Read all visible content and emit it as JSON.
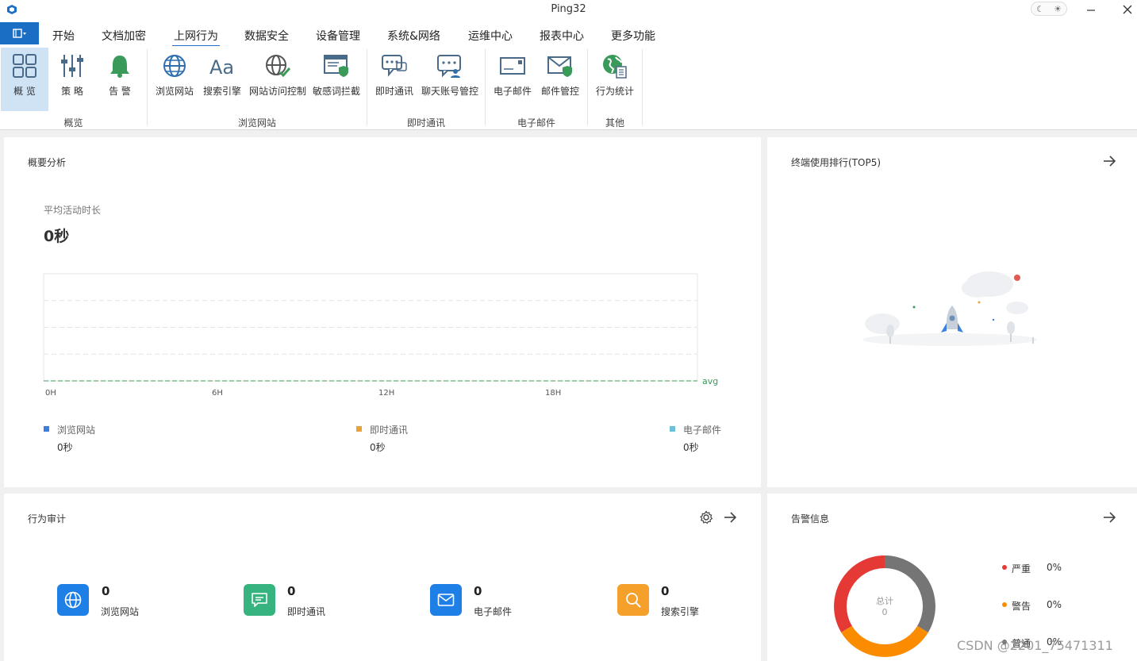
{
  "window": {
    "title": "Ping32"
  },
  "menu": {
    "tabs": [
      "开始",
      "文档加密",
      "上网行为",
      "数据安全",
      "设备管理",
      "系统&网络",
      "运维中心",
      "报表中心",
      "更多功能"
    ],
    "active_index": 2
  },
  "ribbon": {
    "items": [
      {
        "label": "概 览",
        "icon": "overview-grid-icon"
      },
      {
        "label": "策 略",
        "icon": "policy-sliders-icon"
      },
      {
        "label": "告 警",
        "icon": "alarm-bell-icon"
      },
      {
        "label": "浏览网站",
        "icon": "globe-icon"
      },
      {
        "label": "搜索引擎",
        "icon": "font-aa-icon"
      },
      {
        "label": "网站访问控制",
        "icon": "globe-check-icon"
      },
      {
        "label": "敏感词拦截",
        "icon": "window-shield-icon"
      },
      {
        "label": "即时通讯",
        "icon": "chat-bubbles-icon"
      },
      {
        "label": "聊天账号管控",
        "icon": "chat-user-icon"
      },
      {
        "label": "电子邮件",
        "icon": "envelope-icon"
      },
      {
        "label": "邮件管控",
        "icon": "envelope-shield-icon"
      },
      {
        "label": "行为统计",
        "icon": "earth-report-icon"
      }
    ],
    "groups": [
      "概览",
      "浏览网站",
      "即时通讯",
      "电子邮件",
      "其他"
    ]
  },
  "overview": {
    "title": "概要分析",
    "avg_label": "平均活动时长",
    "avg_value": "0秒",
    "chart_data": {
      "type": "line",
      "x_ticks": [
        "0H",
        "6H",
        "12H",
        "18H"
      ],
      "avg_label": "avg",
      "series": [
        {
          "name": "浏览网站",
          "value": "0秒",
          "color": "#3a7fe0"
        },
        {
          "name": "即时通讯",
          "value": "0秒",
          "color": "#e8a23a"
        },
        {
          "name": "电子邮件",
          "value": "0秒",
          "color": "#6cc0d8"
        }
      ]
    }
  },
  "top5": {
    "title": "终端使用排行(TOP5)"
  },
  "audit": {
    "title": "行为审计",
    "items": [
      {
        "count": "0",
        "label": "浏览网站",
        "color": "#1e7fe6",
        "icon": "globe-icon"
      },
      {
        "count": "0",
        "label": "即时通讯",
        "color": "#36b37e",
        "icon": "chat-icon"
      },
      {
        "count": "0",
        "label": "电子邮件",
        "color": "#1e7fe6",
        "icon": "mail-icon"
      },
      {
        "count": "0",
        "label": "搜索引擎",
        "color": "#f5a02a",
        "icon": "search-icon"
      }
    ]
  },
  "alerts": {
    "title": "告警信息",
    "center_label": "总计",
    "center_value": "0",
    "levels": [
      {
        "name": "严重",
        "pct": "0%",
        "color": "#e53935"
      },
      {
        "name": "警告",
        "pct": "0%",
        "color": "#fb8c00"
      },
      {
        "name": "普通",
        "pct": "0%",
        "color": "#757575"
      }
    ]
  },
  "watermark": "CSDN @2201_75471311"
}
